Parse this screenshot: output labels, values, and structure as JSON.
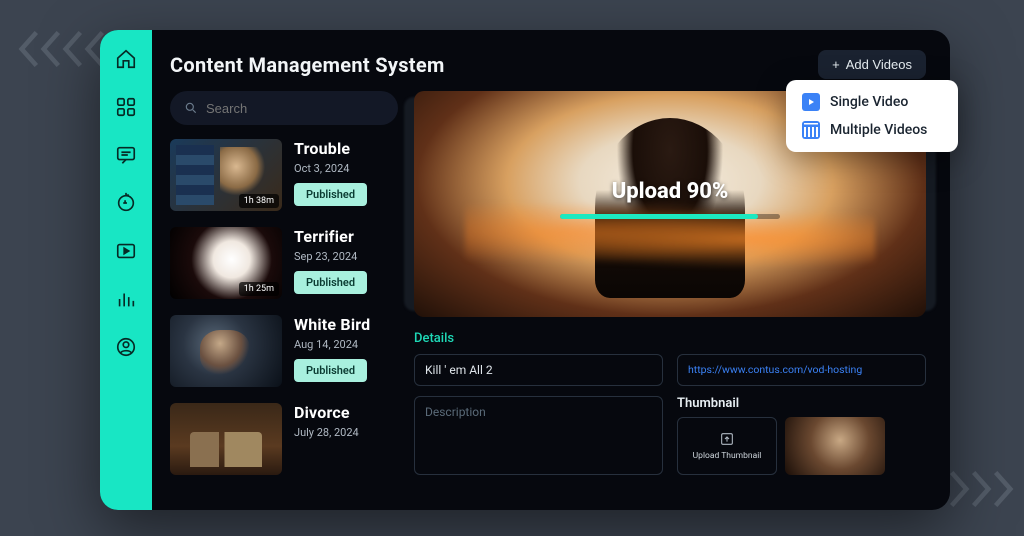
{
  "header": {
    "title": "Content Management System",
    "add_button": "Add Videos"
  },
  "search": {
    "placeholder": "Search"
  },
  "sidebar": {
    "items": [
      "home",
      "apps",
      "comments",
      "refresh",
      "play",
      "analytics",
      "profile"
    ]
  },
  "popup": {
    "single": "Single Video",
    "multiple": "Multiple Videos"
  },
  "videos": [
    {
      "title": "Trouble",
      "date": "Oct 3, 2024",
      "status": "Published",
      "duration": "1h 38m"
    },
    {
      "title": "Terrifier",
      "date": "Sep 23, 2024",
      "status": "Published",
      "duration": "1h 25m"
    },
    {
      "title": "White  Bird",
      "date": "Aug 14, 2024",
      "status": "Published",
      "duration": ""
    },
    {
      "title": "Divorce",
      "date": "July 28, 2024",
      "status": "",
      "duration": ""
    }
  ],
  "upload": {
    "label": "Upload 90%",
    "progress_pct": 90
  },
  "details": {
    "section_label": "Details",
    "title_value": "Kill ' em All 2",
    "url_value": "https://www.contus.com/vod-hosting",
    "description_placeholder": "Description",
    "thumbnail_label": "Thumbnail",
    "upload_thumb_label": "Upload Thumbnail"
  }
}
